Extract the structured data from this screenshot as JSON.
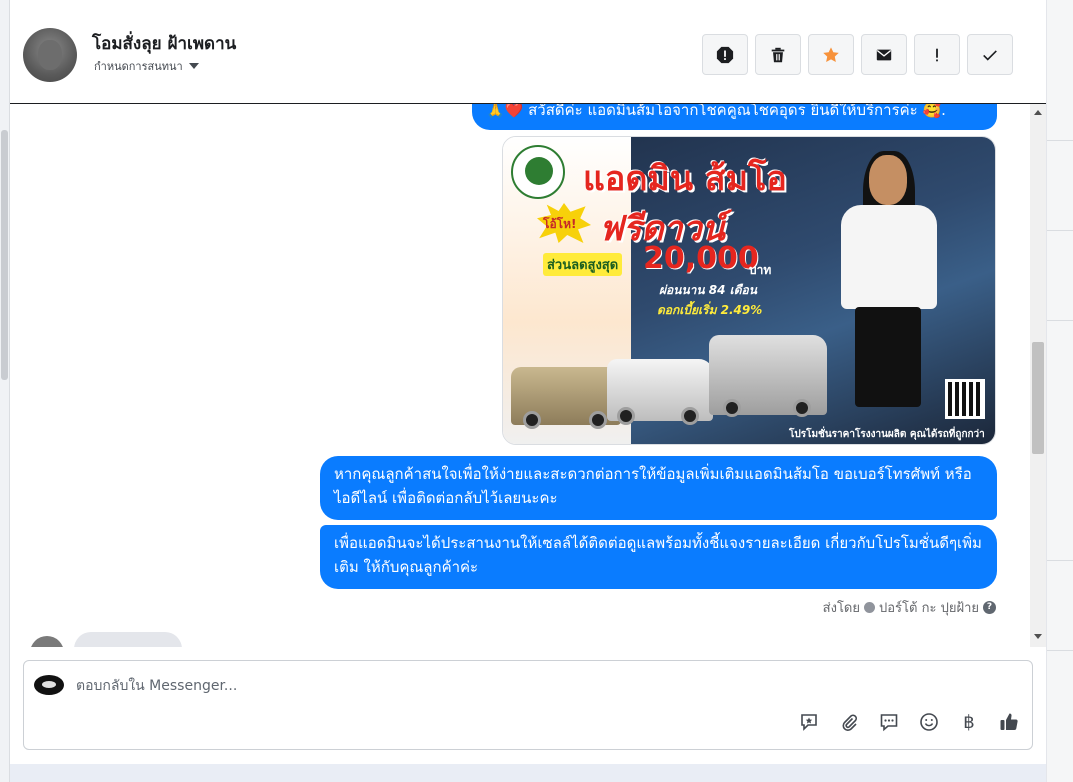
{
  "conversation": {
    "contact_name": "โอมสั่งลุย ฝ้าเพดาน",
    "assign_label": "กำหนดการสนทนา"
  },
  "header_actions": [
    {
      "name": "spam-icon",
      "glyph": "!"
    },
    {
      "name": "trash-icon"
    },
    {
      "name": "star-icon",
      "color": "#f7923b"
    },
    {
      "name": "envelope-icon"
    },
    {
      "name": "exclamation-icon",
      "glyph": "!"
    },
    {
      "name": "check-icon"
    }
  ],
  "messages": {
    "greeting": "🙏❤️ สวัสดีค่ะ แอดมินส้มโอจากโชคคูณโชคอุดร ยินดีให้บริการค่ะ 🥰.",
    "info_1": "หากคุณลูกค้าสนใจเพื่อให้ง่ายและสะดวกต่อการให้ข้อมูลเพิ่มเติมแอดมินส้มโอ ขอเบอร์โทรศัพท์ หรือ ไอดีไลน์ เพื่อติดต่อกลับไว้เลยนะคะ",
    "info_2": "เพื่อแอดมินจะได้ประสานงานให้เซลล์ได้ติดต่อดูแลพร้อมทั้งชี้แจงรายละเอียด เกี่ยวกับโปรโมชั่นดีๆเพิ่มเติม ให้กับคุณลูกค้าค่ะ",
    "sent_by_prefix": "ส่งโดย",
    "sent_by_name": "ปอร์โต้ กะ ปุยฝ้าย",
    "bubble_color": "#0a7cff"
  },
  "promo_image": {
    "title": "แอดมิน ส้มโอ",
    "badge": "โอ้โห!",
    "headline": "ฟรีดาวน์",
    "sale_label": "ส่วนลดสูงสุด",
    "amount": "20,000",
    "unit": "บาท",
    "months": "ผ่อนนาน 84 เดือน",
    "rate": "ดอกเบี้ยเริ่ม 2.49%",
    "footer": "โปรโมชั่นราคาโรงงานผลิต คุณได้รถที่ถูกกว่า"
  },
  "composer": {
    "placeholder": "ตอบกลับใน Messenger...",
    "baht_symbol": "฿"
  }
}
